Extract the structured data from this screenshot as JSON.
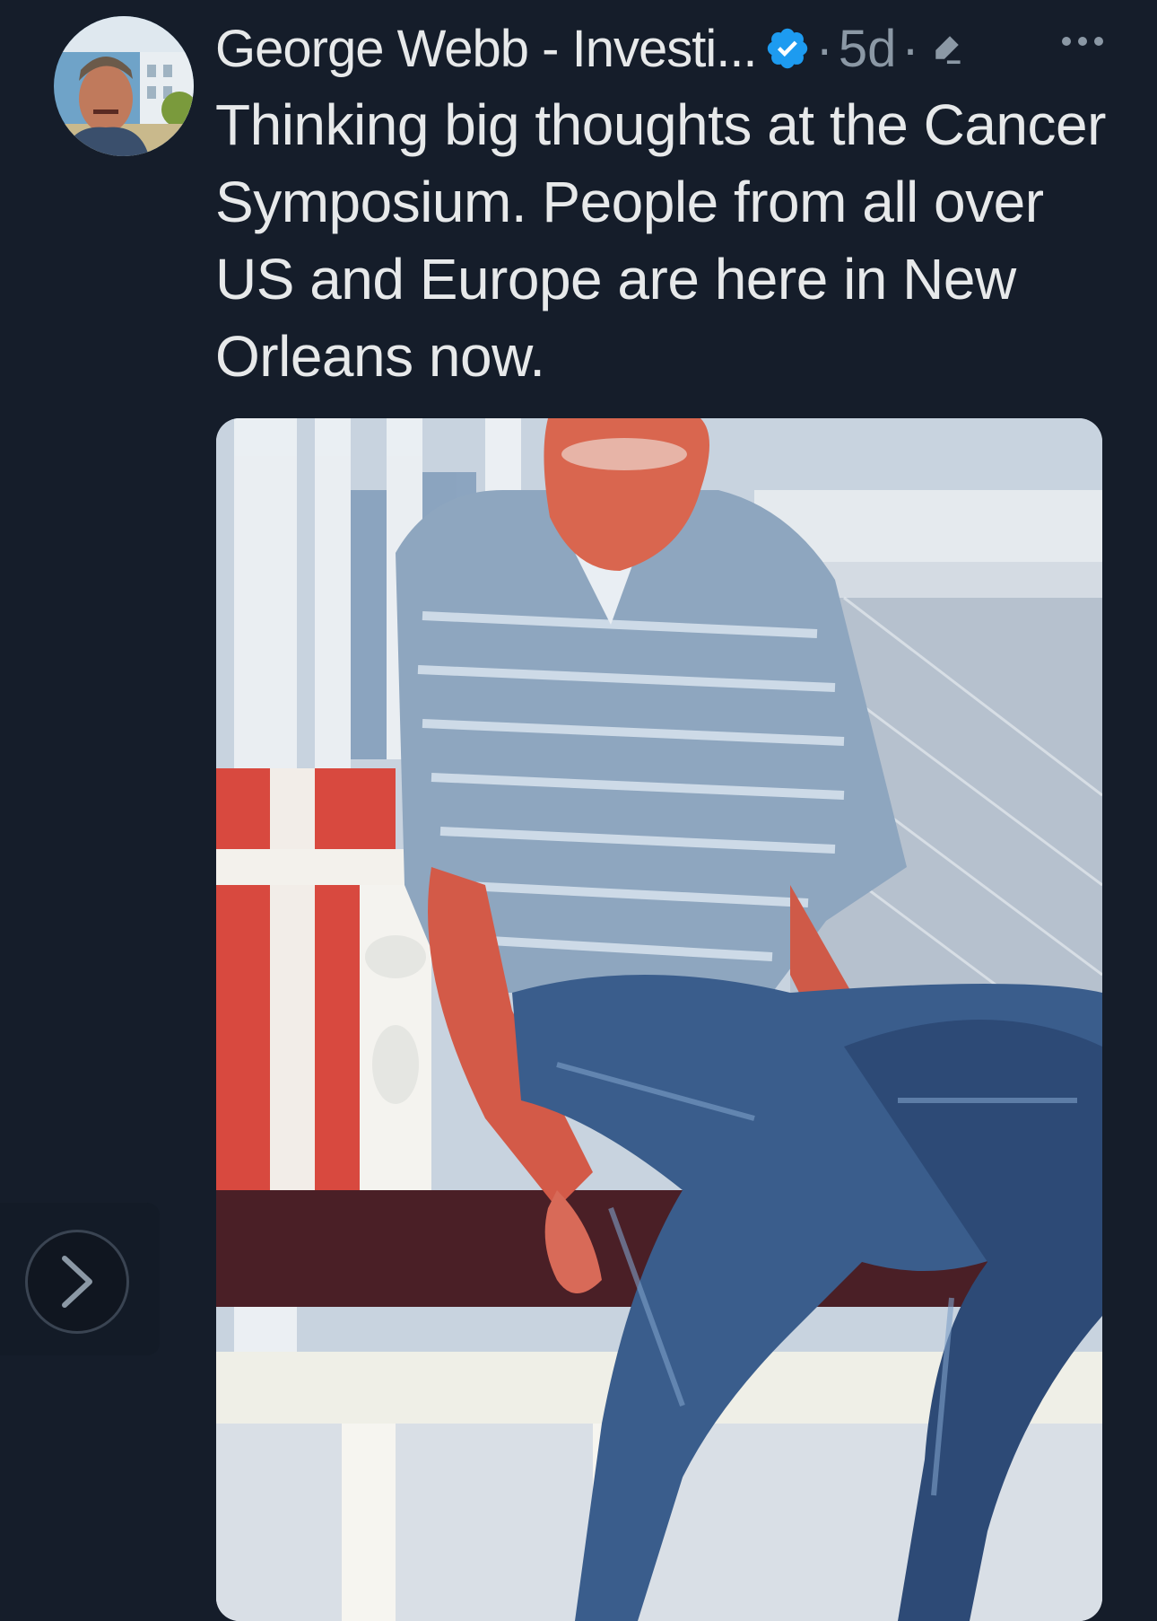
{
  "tweet": {
    "author_name": "George Webb - Investi...",
    "separator_1": "·",
    "timestamp": "5d",
    "separator_2": "·",
    "text": "Thinking big thoughts at the Cancer Symposium. People from all over US and Europe are here in New Orleans now."
  },
  "icons": {
    "verified": "verified-badge-icon",
    "edited": "pencil-edit-icon",
    "more": "more-options-icon",
    "next": "chevron-right-icon"
  },
  "colors": {
    "background": "#151d2a",
    "primary_text": "#e7e9ea",
    "secondary_text": "#8b98a5",
    "verified_blue": "#1d9bf0"
  }
}
